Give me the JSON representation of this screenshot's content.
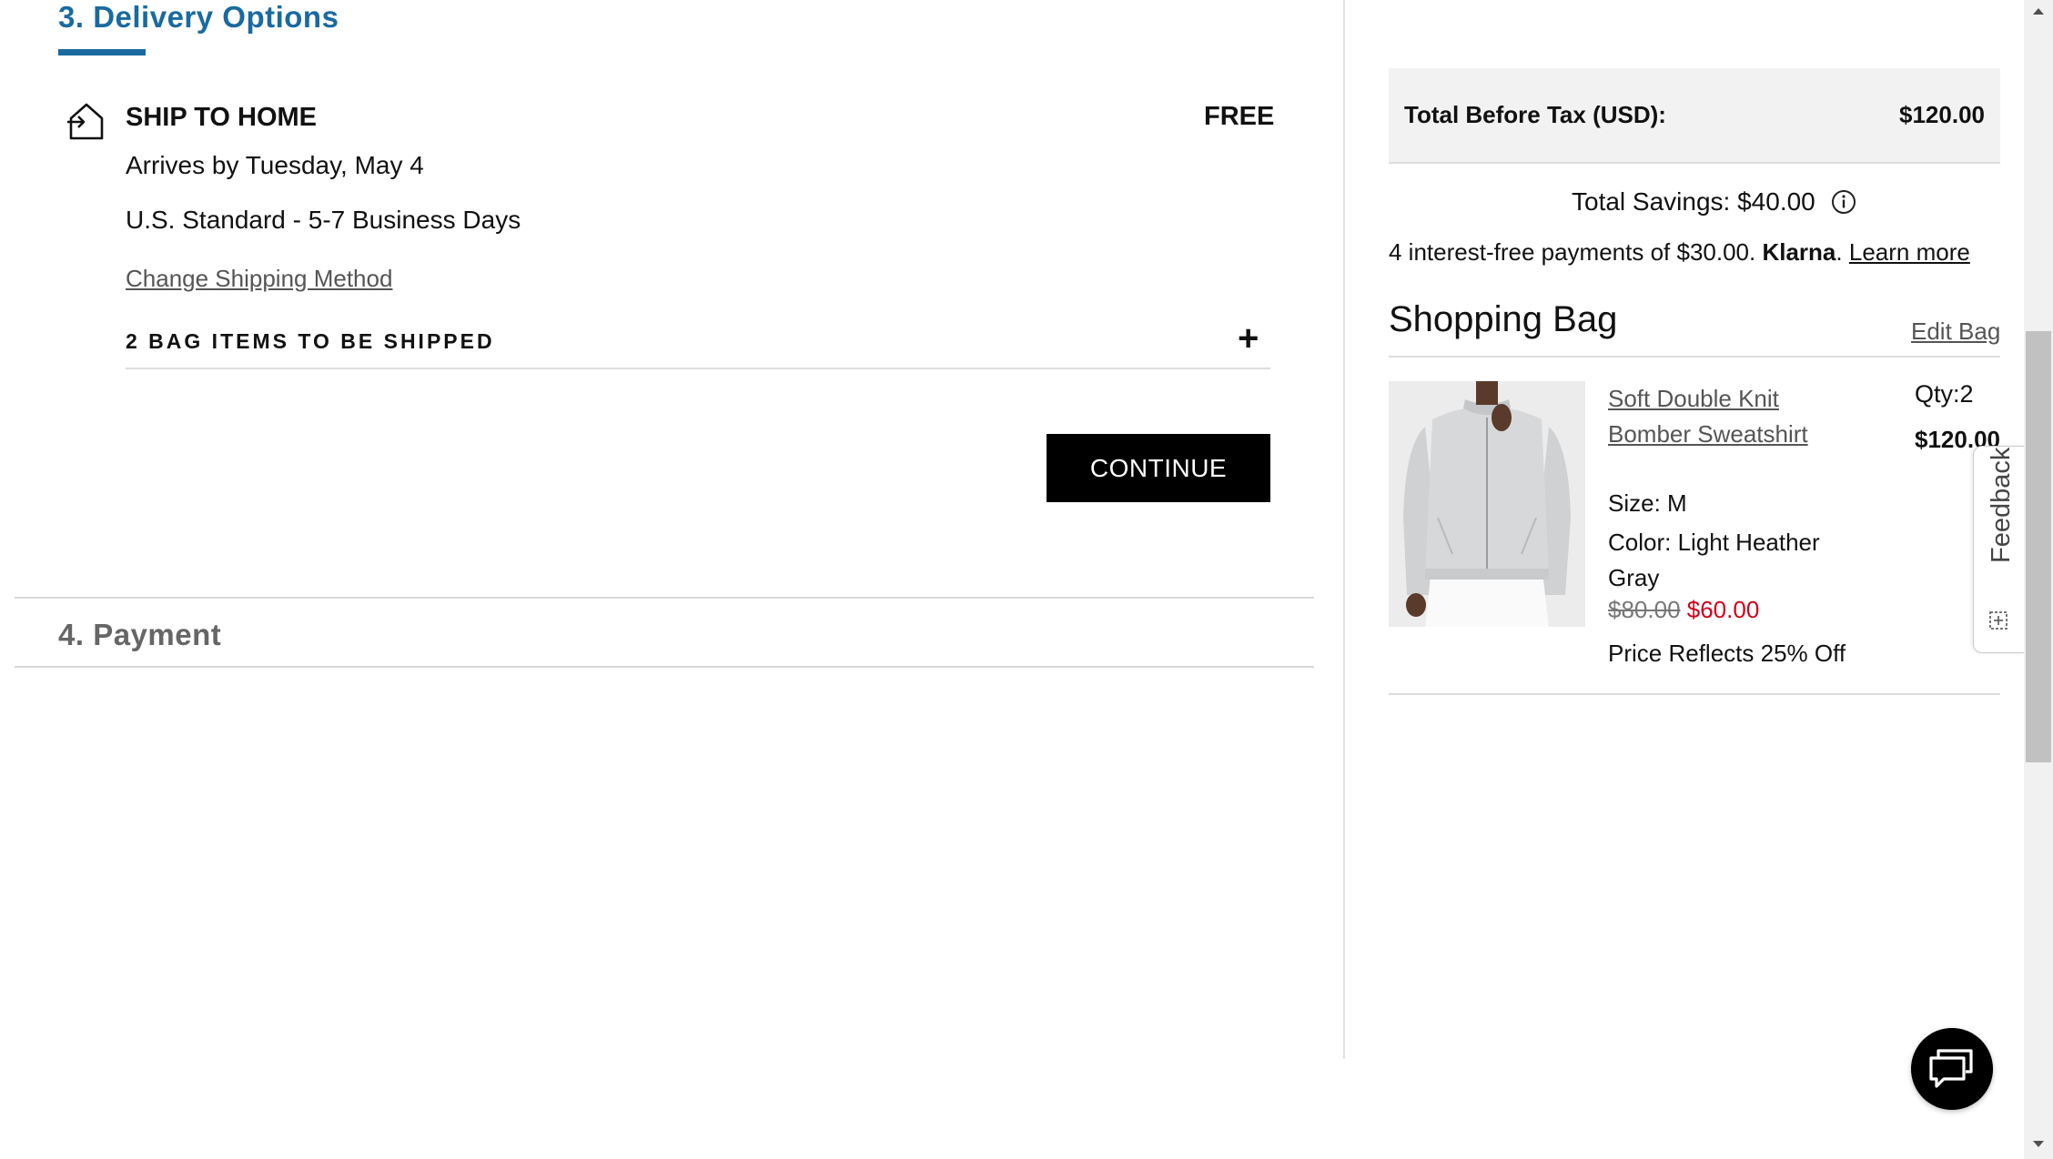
{
  "delivery": {
    "step_title": "3. Delivery Options",
    "ship_title": "SHIP TO HOME",
    "ship_cost": "FREE",
    "arrives": "Arrives by Tuesday, May 4",
    "method": "U.S. Standard - 5-7 Business Days",
    "change_link": "Change Shipping Method",
    "bag_items": "2 BAG ITEMS TO BE SHIPPED",
    "expand_symbol": "+",
    "continue_label": "CONTINUE"
  },
  "payment": {
    "step_title": "4. Payment"
  },
  "summary": {
    "total_label": "Total Before Tax (USD):",
    "total_value": "$120.00",
    "savings": "Total Savings: $40.00",
    "klarna_prefix": "4 interest-free payments of $30.00.",
    "klarna_brand": "Klarna",
    "klarna_period": ".",
    "klarna_learn": "Learn more"
  },
  "bag": {
    "title": "Shopping Bag",
    "edit_label": "Edit Bag",
    "items": [
      {
        "name": "Soft Double Knit Bomber Sweatshirt",
        "size": "Size: M",
        "color": "Color: Light Heather Gray",
        "old_price": "$80.00",
        "new_price": "$60.00",
        "reflects": "Price Reflects 25% Off",
        "qty": "Qty:2",
        "line_price": "$120.00"
      }
    ]
  },
  "feedback": {
    "label": "Feedback"
  },
  "icons": {
    "ship": "ship-to-home-icon",
    "info": "info-icon",
    "chat": "chat-icon",
    "feedback": "feedback-icon"
  },
  "colors": {
    "step_active": "#1a6aa0",
    "sale_price": "#d0021b",
    "button_bg": "#000000"
  }
}
